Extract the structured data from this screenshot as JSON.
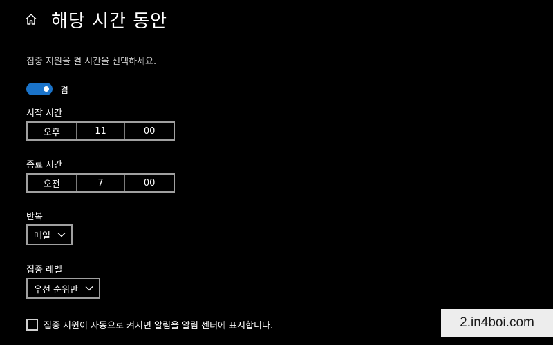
{
  "header": {
    "title": "해당 시간 동안",
    "home_icon": "home-icon"
  },
  "description": "집중 지원을 켤 시간을 선택하세요.",
  "toggle": {
    "state_label": "켬",
    "is_on": true,
    "accent_color": "#1a73c9"
  },
  "start_time": {
    "label": "시작 시간",
    "period": "오후",
    "hour": "11",
    "minute": "00"
  },
  "end_time": {
    "label": "종료 시간",
    "period": "오전",
    "hour": "7",
    "minute": "00"
  },
  "repeat": {
    "label": "반복",
    "selected": "매일",
    "icon": "chevron-down-icon"
  },
  "focus_level": {
    "label": "집중 레벨",
    "selected": "우선 순위만",
    "icon": "chevron-down-icon"
  },
  "notification_checkbox": {
    "label": "집중 지원이 자동으로 켜지면 알림을 알림 센터에 표시합니다.",
    "checked": false
  },
  "watermark": {
    "text": "2.in4boi.com"
  }
}
